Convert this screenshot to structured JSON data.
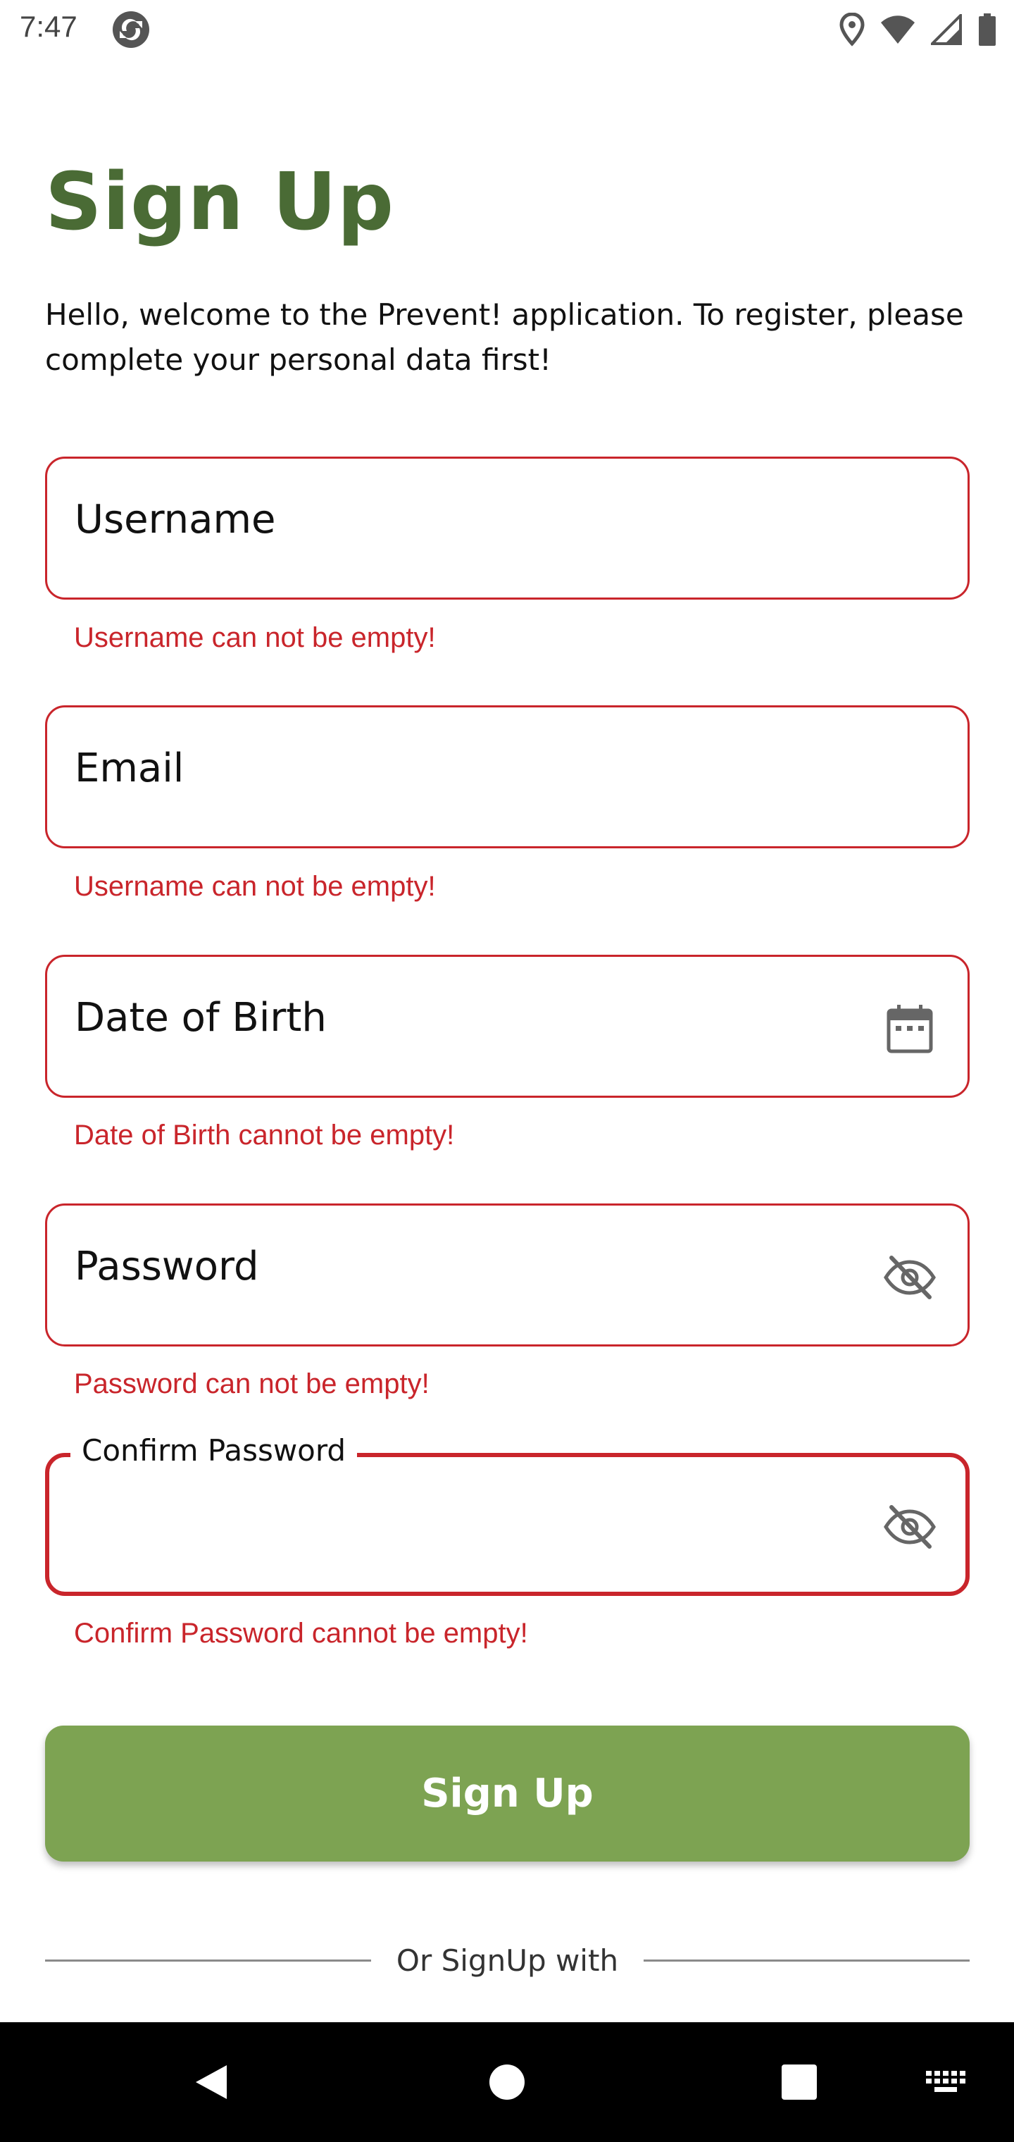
{
  "status_bar": {
    "time": "7:47",
    "icons": [
      "app-sync-icon",
      "location-icon",
      "wifi-icon",
      "signal-icon",
      "battery-icon"
    ]
  },
  "header": {
    "title": "Sign Up",
    "subtitle": "Hello, welcome to the Prevent! application. To register, please complete your personal data first!"
  },
  "form": {
    "username": {
      "label": "Username",
      "error": "Username can not be empty!"
    },
    "email": {
      "label": "Email",
      "error": "Username can not be empty!"
    },
    "dob": {
      "label": "Date of Birth",
      "error": "Date of Birth cannot be empty!",
      "icon": "calendar-icon"
    },
    "password": {
      "label": "Password",
      "error": "Password can not be empty!",
      "icon": "visibility-off-icon"
    },
    "confirm_password": {
      "label": "Confirm Password",
      "value": "",
      "error": "Confirm Password cannot be empty!",
      "icon": "visibility-off-icon"
    }
  },
  "signup_button": {
    "label": "Sign Up"
  },
  "divider": {
    "text": "Or SignUp with"
  },
  "nav_bar": {
    "icons": [
      "back-icon",
      "home-icon",
      "recents-icon",
      "keyboard-icon"
    ]
  },
  "colors": {
    "title": "#4a6b35",
    "button": "#7da352",
    "error": "#c9252b",
    "nav_bar": "#000000"
  }
}
